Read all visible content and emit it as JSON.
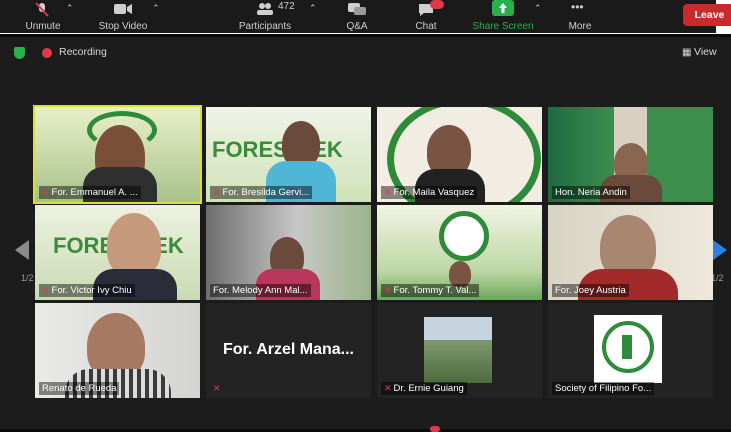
{
  "toolbar": {
    "unmute_label": "Unmute",
    "stop_video_label": "Stop Video",
    "participants_label": "Participants",
    "participants_count": "472",
    "qa_label": "Q&A",
    "chat_label": "Chat",
    "share_screen_label": "Share Screen",
    "more_label": "More",
    "leave_label": "Leave"
  },
  "meeting": {
    "recording_label": "Recording",
    "view_label": "View",
    "page_indicator": "1/2"
  },
  "tiles": [
    {
      "name": "For. Emmanuel A. ..."
    },
    {
      "name": "For. Bresilda Gervi..."
    },
    {
      "name": "For. Maila Vasquez"
    },
    {
      "name": "Hon. Neria Andin"
    },
    {
      "name": "For. Victor Ivy Chiu"
    },
    {
      "name": "For. Melody Ann Mal..."
    },
    {
      "name": "For. Tommy T. Val..."
    },
    {
      "name": "For. Joey Austria"
    },
    {
      "name": "Renato de Rueda"
    },
    {
      "name": "For.  Arzel Mana...",
      "big": "For.  Arzel Mana..."
    },
    {
      "name": "Dr. Ernie Guiang"
    },
    {
      "name": "Society of Filipino Fo..."
    }
  ],
  "colors": {
    "share_green": "#27b04d",
    "leave_red": "#c92a2a",
    "active_speaker": "#d8e033",
    "forest_green": "#2e8b3a"
  }
}
